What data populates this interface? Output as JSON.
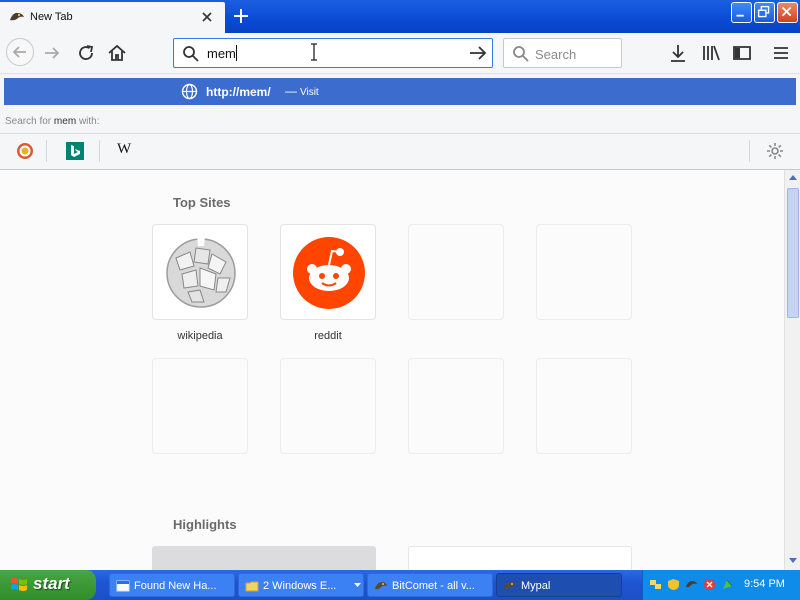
{
  "browser": {
    "tab": {
      "title": "New Tab"
    },
    "urlbar": {
      "value": "mem"
    },
    "searchbox": {
      "placeholder": "Search"
    }
  },
  "dropdown": {
    "suggestion": {
      "url_prefix": "http://",
      "url_bold": "mem/",
      "separator": "—",
      "action": "Visit"
    },
    "search_for": {
      "prefix": "Search for",
      "term": "mem",
      "suffix": "with:"
    },
    "engines": [
      "duckduckgo",
      "bing",
      "wikipedia"
    ],
    "wiki_glyph": "W"
  },
  "newtab": {
    "top_sites": {
      "title": "Top Sites",
      "tiles": [
        {
          "label": "wikipedia",
          "icon": "wikipedia-globe-icon"
        },
        {
          "label": "reddit",
          "icon": "reddit-alien-icon"
        }
      ]
    },
    "highlights": {
      "title": "Highlights"
    }
  },
  "taskbar": {
    "start_label": "start",
    "tasks": [
      {
        "label": "Found New Ha...",
        "icon": "window-icon"
      },
      {
        "label": "2 Windows E...",
        "icon": "folder-icon"
      },
      {
        "label": "BitComet - all v...",
        "icon": "bitcomet-icon"
      },
      {
        "label": "Mypal",
        "icon": "mypal-icon"
      }
    ],
    "clock": "9:54 PM"
  },
  "colors": {
    "accent": "#3d6ccf",
    "reddit": "#ff4500",
    "xp_blue": "#1f55d2",
    "xp_green": "#3a9a34"
  }
}
